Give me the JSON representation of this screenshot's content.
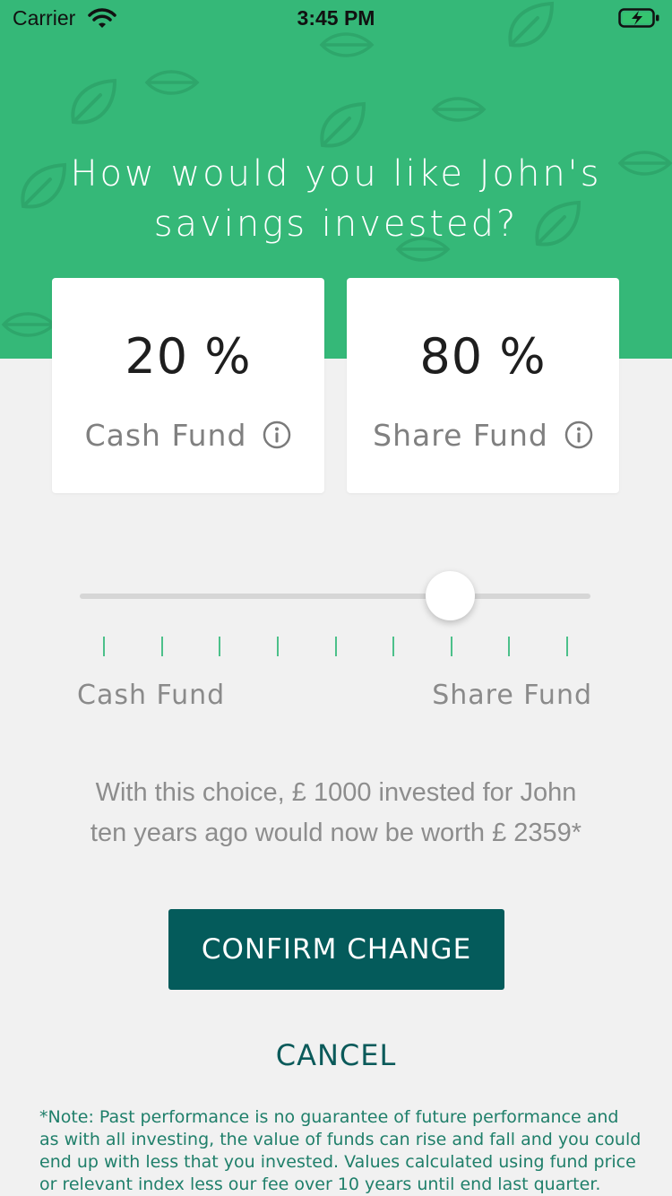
{
  "status_bar": {
    "carrier": "Carrier",
    "time": "3:45 PM",
    "icons": [
      "wifi-icon",
      "battery-charging-icon"
    ]
  },
  "hero": {
    "background_color": "#35b878",
    "headline_line1": "How would you like John's",
    "headline_line2": "savings invested?",
    "pattern_icon": "leaf-icon"
  },
  "allocation": {
    "cash": {
      "percent": "20 %",
      "label": "Cash Fund",
      "info_icon": "info-icon"
    },
    "share": {
      "percent": "80 %",
      "label": "Share Fund",
      "info_icon": "info-icon"
    }
  },
  "slider": {
    "value_percent_share": 80,
    "tick_count": 9,
    "left_label": "Cash Fund",
    "right_label": "Share Fund",
    "tick_color": "#4cc08a"
  },
  "summary": {
    "line1": "With this choice,  £ 1000 invested for John",
    "line2": "ten years ago would now be worth  £ 2359*"
  },
  "actions": {
    "confirm_label": "CONFIRM CHANGE",
    "confirm_color": "#045b5b",
    "cancel_label": "CANCEL"
  },
  "note": "*Note: Past performance is no guarantee of future performance and as with all investing, the value of funds can rise and fall and you could end up with less that you invested. Values calculated using fund price or relevant index less our fee over 10 years until end last quarter."
}
